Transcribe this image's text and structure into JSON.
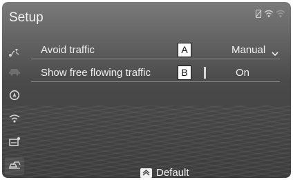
{
  "header": {
    "title": "Setup"
  },
  "status_icons": [
    "phone-icon",
    "wifi-icon",
    "signal-icon"
  ],
  "sidebar": {
    "items": [
      {
        "icon": "voice-navigation-icon",
        "selected": false
      },
      {
        "icon": "car-icon",
        "selected": false
      },
      {
        "icon": "info-icon",
        "selected": false
      },
      {
        "icon": "wifi-icon",
        "selected": false
      },
      {
        "icon": "display-icon",
        "selected": false
      },
      {
        "icon": "traffic-icon",
        "selected": true
      }
    ]
  },
  "settings": [
    {
      "label": "Avoid traffic",
      "callout": "A",
      "value": "Manual",
      "control": "dropdown"
    },
    {
      "label": "Show free flowing traffic",
      "callout": "B",
      "value": "On",
      "control": "toggle"
    }
  ],
  "footer": {
    "default_label": "Default",
    "icon": "default-icon"
  }
}
